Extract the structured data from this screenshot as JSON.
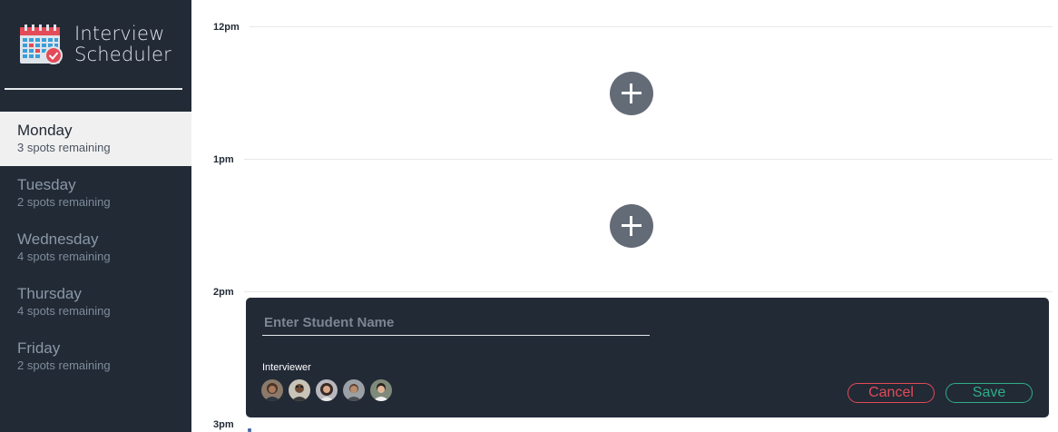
{
  "app": {
    "title_line1": "Interview",
    "title_line2": "Scheduler"
  },
  "sidebar": {
    "days": [
      {
        "name": "Monday",
        "spots": "3 spots remaining",
        "selected": true
      },
      {
        "name": "Tuesday",
        "spots": "2 spots remaining",
        "selected": false
      },
      {
        "name": "Wednesday",
        "spots": "4 spots remaining",
        "selected": false
      },
      {
        "name": "Thursday",
        "spots": "4 spots remaining",
        "selected": false
      },
      {
        "name": "Friday",
        "spots": "2 spots remaining",
        "selected": false
      }
    ]
  },
  "schedule": {
    "times": [
      "12pm",
      "1pm",
      "2pm",
      "3pm"
    ]
  },
  "form": {
    "student_placeholder": "Enter Student Name",
    "student_value": "",
    "interviewer_label": "Interviewer",
    "interviewers": [
      {
        "icon": "avatar-1"
      },
      {
        "icon": "avatar-2"
      },
      {
        "icon": "avatar-3"
      },
      {
        "icon": "avatar-4"
      },
      {
        "icon": "avatar-5"
      }
    ],
    "cancel_label": "Cancel",
    "save_label": "Save"
  },
  "colors": {
    "sidebar_bg": "#222a36",
    "selected_day_bg": "#f0f0f0",
    "cancel": "#e24b57",
    "save": "#2fae85",
    "add_button": "#636b77"
  }
}
